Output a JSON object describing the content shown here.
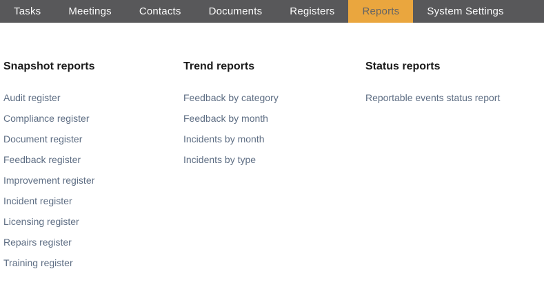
{
  "nav": {
    "items": [
      {
        "label": "Tasks",
        "active": false
      },
      {
        "label": "Meetings",
        "active": false
      },
      {
        "label": "Contacts",
        "active": false
      },
      {
        "label": "Documents",
        "active": false
      },
      {
        "label": "Registers",
        "active": false
      },
      {
        "label": "Reports",
        "active": true
      },
      {
        "label": "System Settings",
        "active": false
      }
    ]
  },
  "sections": [
    {
      "title": "Snapshot reports",
      "links": [
        "Audit register",
        "Compliance register",
        "Document register",
        "Feedback register",
        "Improvement register",
        "Incident register",
        "Licensing register",
        "Repairs register",
        "Training register"
      ]
    },
    {
      "title": "Trend reports",
      "links": [
        "Feedback by category",
        "Feedback by month",
        "Incidents by month",
        "Incidents by type"
      ]
    },
    {
      "title": "Status reports",
      "links": [
        "Reportable events status report"
      ]
    }
  ],
  "colors": {
    "nav_background": "#58585a",
    "active_tab_background": "#eaa63e",
    "active_tab_text": "#646464",
    "nav_text": "#fbfbfb",
    "section_title_text": "#1b1b1b",
    "link_text": "#5d6d83"
  }
}
